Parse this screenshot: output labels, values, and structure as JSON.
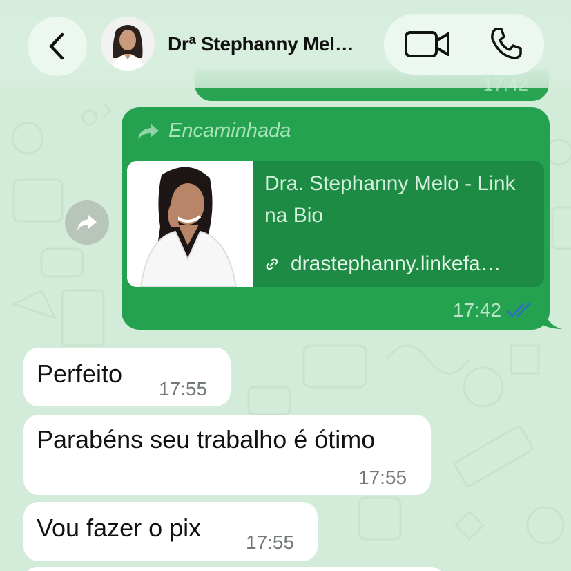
{
  "header": {
    "contact_name": "Drª Stephanny Mel…",
    "back_icon": "chevron-left-icon",
    "video_icon": "video-camera-icon",
    "phone_icon": "phone-icon"
  },
  "messages": {
    "prev_time": "17:42",
    "forwarded": {
      "label": "Encaminhada",
      "link_title": "Dra. Stephanny Melo - Link na Bio",
      "link_url": "drastephanny.linkefa…",
      "time": "17:42",
      "status": "read"
    },
    "incoming": [
      {
        "text": "Perfeito",
        "time": "17:55"
      },
      {
        "text": "Parabéns seu trabalho é ótimo",
        "time": "17:55"
      },
      {
        "text": "Vou fazer o pix",
        "time": "17:55"
      }
    ]
  },
  "colors": {
    "outgoing_bubble": "#25a250",
    "link_card": "#1e8b44",
    "wallpaper": "#d3ecd9",
    "read_ticks": "#2f6fc1"
  }
}
